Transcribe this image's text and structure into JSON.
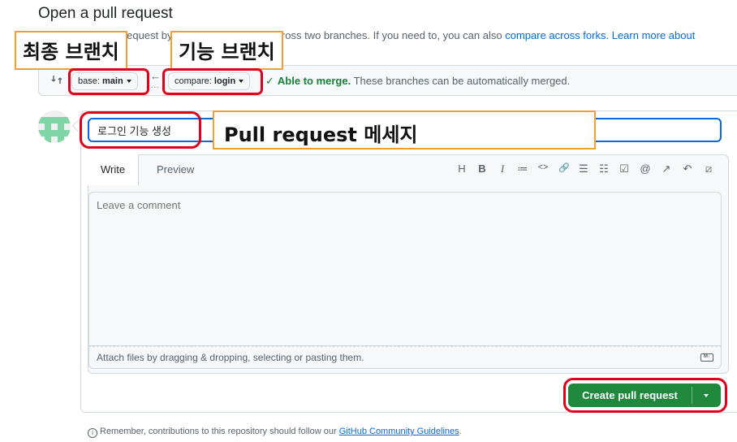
{
  "header": {
    "title": "Open a pull request",
    "description_prefix": "Create a new pull request by comparing changes across two branches. If you need to, you can also ",
    "compare_forks_link": "compare across forks.",
    "learn_more_link": "Learn more about"
  },
  "compare": {
    "base_prefix": "base:",
    "base_branch": "main",
    "compare_prefix": "compare:",
    "compare_branch": "login",
    "arrow": "←",
    "dots": "...",
    "merge_ok": "Able to merge.",
    "merge_detail": "These branches can be automatically merged."
  },
  "form": {
    "title_value": "로그인 기능 생성",
    "tab_write": "Write",
    "tab_preview": "Preview",
    "comment_placeholder": "Leave a comment",
    "attach_text": "Attach files by dragging & dropping, selecting or pasting them.",
    "markdown_badge": "M↓",
    "toolbar": [
      "H",
      "B",
      "I",
      "≔",
      "<>",
      "🔗",
      "☰",
      "☷",
      "☑",
      "@",
      "↗",
      "↶",
      "⧄"
    ]
  },
  "actions": {
    "create_label": "Create pull request"
  },
  "footer": {
    "prefix": "Remember, contributions to this repository should follow our ",
    "link": "GitHub Community Guidelines",
    "suffix": "."
  },
  "annotations": {
    "base_label": "최종 브랜치",
    "compare_label": "기능 브랜치",
    "title_label": "Pull request 메세지"
  },
  "colors": {
    "accent_blue": "#0969da",
    "primary_green": "#1f883d",
    "annotation_orange": "#f0a030",
    "annotation_red": "#e0001b"
  }
}
